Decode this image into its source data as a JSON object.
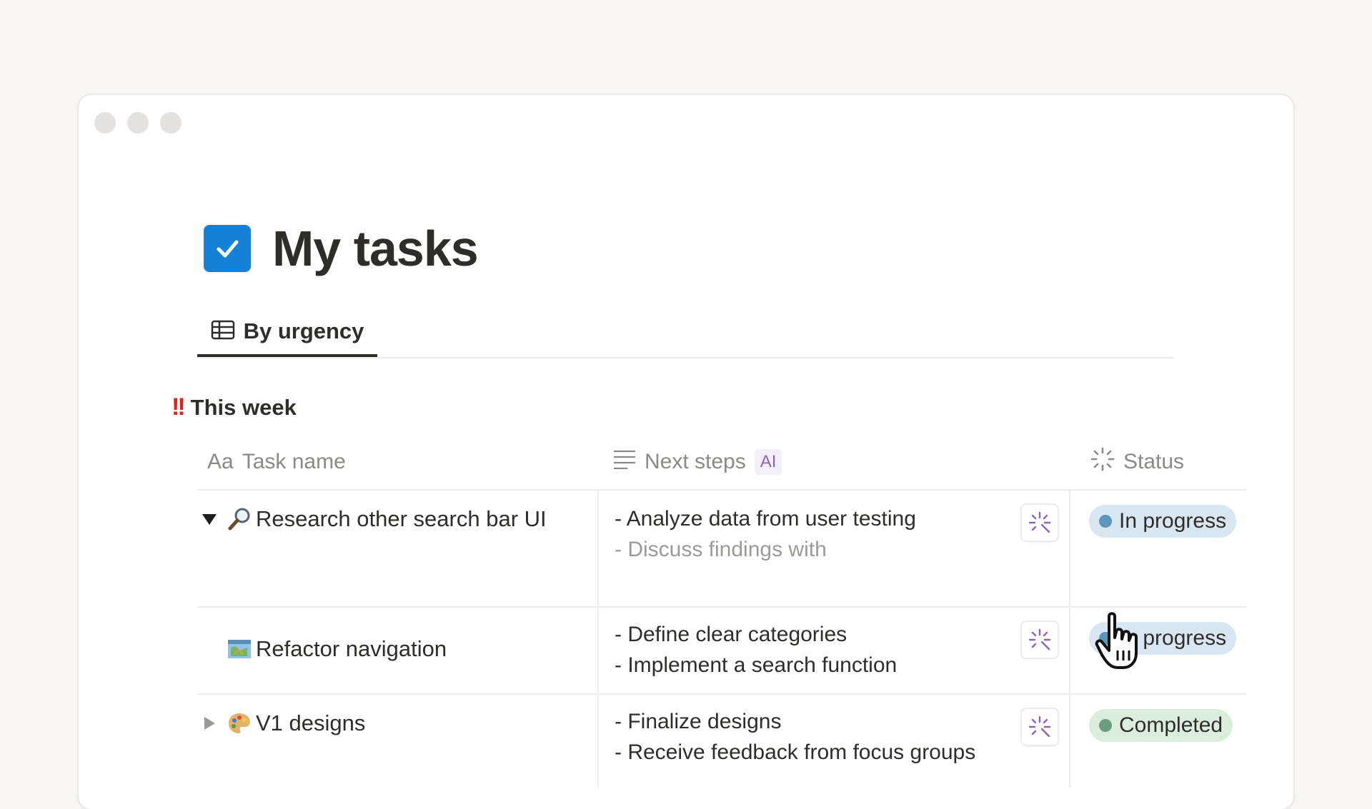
{
  "page": {
    "title": "My tasks",
    "view_tab": "By urgency"
  },
  "group": {
    "emoji": "!!",
    "title": "This week"
  },
  "columns": {
    "task_name": "Task name",
    "task_name_prefix": "Aa",
    "next_steps": "Next steps",
    "ai_badge": "AI",
    "status": "Status"
  },
  "rows": [
    {
      "task": "Research other search bar UI",
      "icon": "magnifying-glass-icon",
      "expanded": true,
      "step1": "- Analyze data from user testing",
      "step2": "- Discuss findings with",
      "status": "In progress",
      "status_color": "#5b97bd"
    },
    {
      "task": "Refactor navigation",
      "icon": "map-icon",
      "expanded": null,
      "step1": "- Define clear categories",
      "step2": "- Implement a search function",
      "status": "In progress",
      "status_color": "#5b97bd"
    },
    {
      "task": "V1 designs",
      "icon": "palette-icon",
      "expanded": false,
      "step1": "- Finalize designs",
      "step2": "- Receive feedback from focus groups",
      "status": "Completed",
      "status_color": "#6c9b7d"
    }
  ],
  "colors": {
    "accent_checkbox": "#1580d8",
    "ai_purple": "#9065b0"
  }
}
